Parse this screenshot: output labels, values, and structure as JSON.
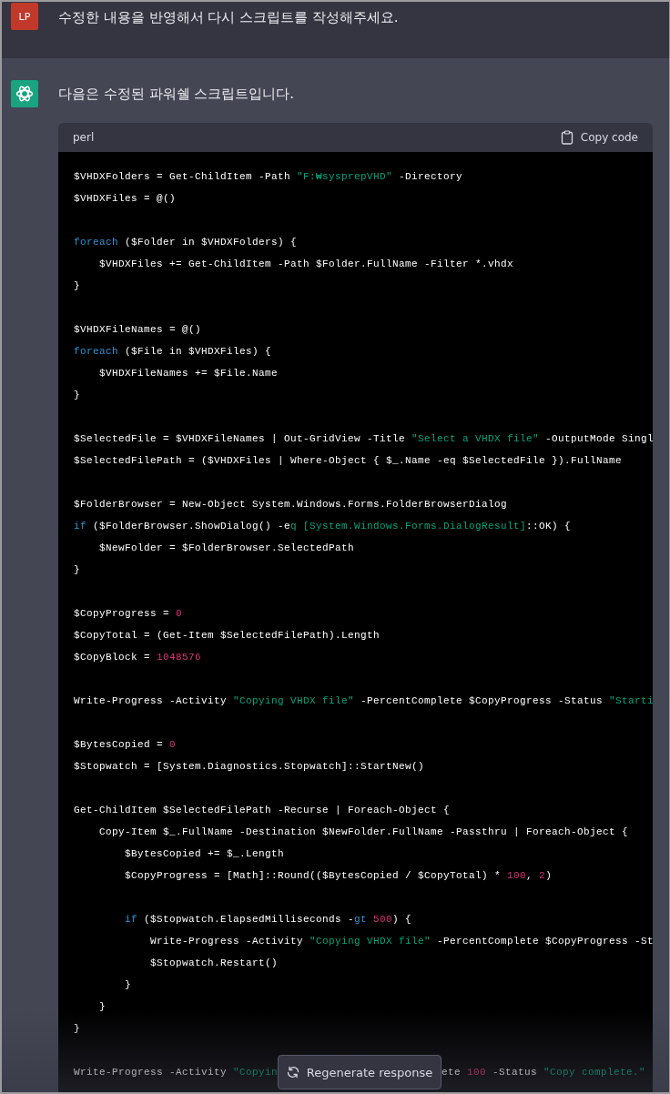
{
  "messages": [
    {
      "kind": "user",
      "avatar": "LP",
      "text": "수정한 내용을 반영해서 다시 스크립트를 작성해주세요."
    },
    {
      "kind": "assistant",
      "text": "다음은 수정된 파워쉘 스크립트입니다.",
      "code_block": {
        "language": "perl",
        "copy_label": "Copy code",
        "lines": [
          {
            "kind": "code",
            "tokens": [
              {
                "kind": "plain",
                "text": "$VHDXFolders = Get-ChildItem -Path "
              },
              {
                "kind": "string",
                "text": "\"F:₩sysprepVHD\""
              },
              {
                "kind": "plain",
                "text": " -Directory"
              }
            ]
          },
          {
            "kind": "code",
            "tokens": [
              {
                "kind": "plain",
                "text": "$VHDXFiles = @()"
              }
            ]
          },
          {
            "kind": "blank"
          },
          {
            "kind": "code",
            "tokens": [
              {
                "kind": "keyword",
                "text": "foreach"
              },
              {
                "kind": "plain",
                "text": " ($Folder in $VHDXFolders) {"
              }
            ]
          },
          {
            "kind": "code",
            "tokens": [
              {
                "kind": "plain",
                "text": "    $VHDXFiles += Get-ChildItem -Path $Folder.FullName -Filter *.vhdx"
              }
            ]
          },
          {
            "kind": "code",
            "tokens": [
              {
                "kind": "plain",
                "text": "}"
              }
            ]
          },
          {
            "kind": "blank"
          },
          {
            "kind": "code",
            "tokens": [
              {
                "kind": "plain",
                "text": "$VHDXFileNames = @()"
              }
            ]
          },
          {
            "kind": "code",
            "tokens": [
              {
                "kind": "keyword",
                "text": "foreach"
              },
              {
                "kind": "plain",
                "text": " ($File in $VHDXFiles) {"
              }
            ]
          },
          {
            "kind": "code",
            "tokens": [
              {
                "kind": "plain",
                "text": "    $VHDXFileNames += $File.Name"
              }
            ]
          },
          {
            "kind": "code",
            "tokens": [
              {
                "kind": "plain",
                "text": "}"
              }
            ]
          },
          {
            "kind": "blank"
          },
          {
            "kind": "code",
            "tokens": [
              {
                "kind": "plain",
                "text": "$SelectedFile = $VHDXFileNames | Out-GridView -Title "
              },
              {
                "kind": "string",
                "text": "\"Select a VHDX file\""
              },
              {
                "kind": "plain",
                "text": " -OutputMode Singl"
              }
            ]
          },
          {
            "kind": "code",
            "tokens": [
              {
                "kind": "plain",
                "text": "$SelectedFilePath = ($VHDXFiles | Where-Object { $_.Name -eq $SelectedFile }).FullName"
              }
            ]
          },
          {
            "kind": "blank"
          },
          {
            "kind": "code",
            "tokens": [
              {
                "kind": "plain",
                "text": "$FolderBrowser = New-Object System.Windows.Forms.FolderBrowserDialog"
              }
            ]
          },
          {
            "kind": "code",
            "tokens": [
              {
                "kind": "keyword",
                "text": "if"
              },
              {
                "kind": "plain",
                "text": " ($FolderBrowser.ShowDialog() -e"
              },
              {
                "kind": "string",
                "text": "q [System.Windows.Forms.DialogResult]"
              },
              {
                "kind": "plain",
                "text": "::OK) {"
              }
            ]
          },
          {
            "kind": "code",
            "tokens": [
              {
                "kind": "plain",
                "text": "    $NewFolder = $FolderBrowser.SelectedPath"
              }
            ]
          },
          {
            "kind": "code",
            "tokens": [
              {
                "kind": "plain",
                "text": "}"
              }
            ]
          },
          {
            "kind": "blank"
          },
          {
            "kind": "code",
            "tokens": [
              {
                "kind": "plain",
                "text": "$CopyProgress = "
              },
              {
                "kind": "number",
                "text": "0"
              }
            ]
          },
          {
            "kind": "code",
            "tokens": [
              {
                "kind": "plain",
                "text": "$CopyTotal = (Get-Item $SelectedFilePath).Length"
              }
            ]
          },
          {
            "kind": "code",
            "tokens": [
              {
                "kind": "plain",
                "text": "$CopyBlock = "
              },
              {
                "kind": "number",
                "text": "1048576"
              }
            ]
          },
          {
            "kind": "blank"
          },
          {
            "kind": "code",
            "tokens": [
              {
                "kind": "plain",
                "text": "Write-Progress -Activity "
              },
              {
                "kind": "string",
                "text": "\"Copying VHDX file\""
              },
              {
                "kind": "plain",
                "text": " -PercentComplete $CopyProgress -Status "
              },
              {
                "kind": "string",
                "text": "\"Starti"
              }
            ]
          },
          {
            "kind": "blank"
          },
          {
            "kind": "code",
            "tokens": [
              {
                "kind": "plain",
                "text": "$BytesCopied = "
              },
              {
                "kind": "number",
                "text": "0"
              }
            ]
          },
          {
            "kind": "code",
            "tokens": [
              {
                "kind": "plain",
                "text": "$Stopwatch = [System.Diagnostics.Stopwatch]::StartNew()"
              }
            ]
          },
          {
            "kind": "blank"
          },
          {
            "kind": "code",
            "tokens": [
              {
                "kind": "plain",
                "text": "Get-ChildItem $SelectedFilePath -Recurse | Foreach-Object {"
              }
            ]
          },
          {
            "kind": "code",
            "tokens": [
              {
                "kind": "plain",
                "text": "    Copy-Item $_.FullName -Destination $NewFolder.FullName -Passthru | Foreach-Object {"
              }
            ]
          },
          {
            "kind": "code",
            "tokens": [
              {
                "kind": "plain",
                "text": "        $BytesCopied += $_.Length"
              }
            ]
          },
          {
            "kind": "code",
            "tokens": [
              {
                "kind": "plain",
                "text": "        $CopyProgress = [Math]::Round(($BytesCopied / $CopyTotal) * "
              },
              {
                "kind": "number",
                "text": "100"
              },
              {
                "kind": "plain",
                "text": ", "
              },
              {
                "kind": "number",
                "text": "2"
              },
              {
                "kind": "plain",
                "text": ")"
              }
            ]
          },
          {
            "kind": "blank"
          },
          {
            "kind": "code",
            "tokens": [
              {
                "kind": "keyword",
                "text": "        if"
              },
              {
                "kind": "plain",
                "text": " ($Stopwatch.ElapsedMilliseconds -"
              },
              {
                "kind": "keyword",
                "text": "gt"
              },
              {
                "kind": "number",
                "text": " 500"
              },
              {
                "kind": "plain",
                "text": ") {"
              }
            ]
          },
          {
            "kind": "code",
            "tokens": [
              {
                "kind": "plain",
                "text": "            Write-Progress -Activity "
              },
              {
                "kind": "string",
                "text": "\"Copying VHDX file\""
              },
              {
                "kind": "plain",
                "text": " -PercentComplete $CopyProgress -St"
              }
            ]
          },
          {
            "kind": "code",
            "tokens": [
              {
                "kind": "plain",
                "text": "            $Stopwatch.Restart()"
              }
            ]
          },
          {
            "kind": "code",
            "tokens": [
              {
                "kind": "plain",
                "text": "        }"
              }
            ]
          },
          {
            "kind": "code",
            "tokens": [
              {
                "kind": "plain",
                "text": "    }"
              }
            ]
          },
          {
            "kind": "code",
            "tokens": [
              {
                "kind": "plain",
                "text": "}"
              }
            ]
          },
          {
            "kind": "blank"
          },
          {
            "kind": "split",
            "left": [
              {
                "kind": "plain",
                "text": "Write-Progress -Activity "
              },
              {
                "kind": "string",
                "text": "\"Copyin"
              }
            ],
            "right": [
              {
                "kind": "plain",
                "text": "ete "
              },
              {
                "kind": "number",
                "text": "100"
              },
              {
                "kind": "plain",
                "text": " -Status "
              },
              {
                "kind": "string",
                "text": "\"Copy complete.\""
              }
            ]
          }
        ]
      }
    }
  ],
  "regenerate_button": {
    "label": "Regenerate response"
  }
}
